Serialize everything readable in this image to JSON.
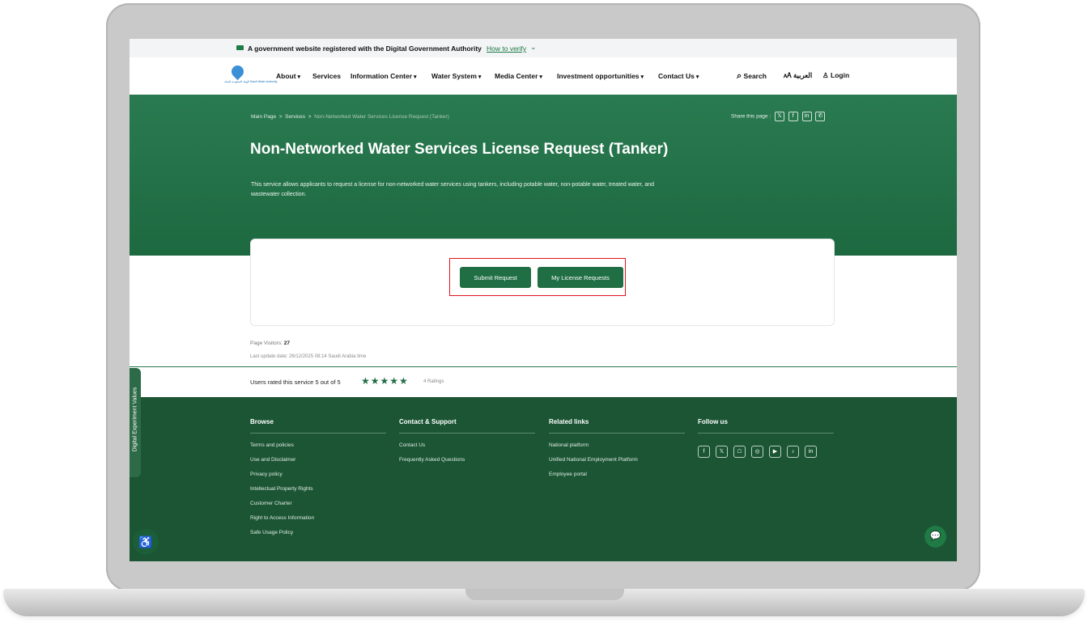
{
  "topbar": {
    "message": "A government website registered with the Digital Government Authority",
    "verify_link": "How to verify",
    "verify_icon": "chevron-down-icon"
  },
  "logo": {
    "caption": "الهيئة السعودية للمياه Saudi Water Authority"
  },
  "nav": {
    "items": [
      {
        "label": "About",
        "dropdown": true
      },
      {
        "label": "Services",
        "dropdown": false
      },
      {
        "label": "Information Center",
        "dropdown": true
      },
      {
        "label": "Water System",
        "dropdown": true
      },
      {
        "label": "Media Center",
        "dropdown": true
      },
      {
        "label": "Investment opportunities",
        "dropdown": true
      },
      {
        "label": "Contact Us",
        "dropdown": true
      }
    ],
    "search_label": "Search",
    "language_label": "العربية",
    "login_label": "Login"
  },
  "hero": {
    "breadcrumb": {
      "home": "Main Page",
      "sep1": ">",
      "services": "Services",
      "sep2": ">",
      "current": "Non-Networked Water Services License Request (Tanker)"
    },
    "share_label": "Share this page :",
    "share_icons": [
      "x-icon",
      "facebook-icon",
      "linkedin-icon",
      "whatsapp-icon"
    ],
    "title": "Non-Networked Water Services License Request (Tanker)",
    "description": "This service allows applicants to request a license for non-networked water services using tankers, including potable water, non-potable water, treated water, and wastewater collection."
  },
  "actions": {
    "submit_label": "Submit Request",
    "my_requests_label": "My License Requests"
  },
  "meta": {
    "visitors_label": "Page Visitors:",
    "visitors_count": "27",
    "last_update": "Last update date: 26/12/2025 08:14 Saudi Arabia time"
  },
  "rating": {
    "text": "Users rated this service 5 out of 5",
    "stars": 5,
    "count_label": "4 Ratings"
  },
  "footer": {
    "browse": {
      "title": "Browse",
      "links": [
        "Terms and policies",
        "Use and Disclaimer",
        "Privacy policy",
        "Intellectual Property Rights",
        "Customer Charter",
        "Right to Access Information",
        "Safe Usage Policy"
      ]
    },
    "contact": {
      "title": "Contact & Support",
      "links": [
        "Contact Us",
        "Frequently Asked Questions"
      ]
    },
    "related": {
      "title": "Related links",
      "links": [
        "National platform",
        "Unified National Employment Platform",
        "Employee portal"
      ]
    },
    "follow": {
      "title": "Follow us",
      "icons": [
        "facebook-icon",
        "x-icon",
        "snapchat-icon",
        "instagram-icon",
        "youtube-icon",
        "tiktok-icon",
        "linkedin-icon"
      ]
    }
  },
  "side_tab_label": "Digital Experiment Values",
  "colors": {
    "primary": "#1f6e44",
    "hero": "#2a7a51",
    "footer": "#1b5534",
    "highlight": "#e0151f"
  }
}
